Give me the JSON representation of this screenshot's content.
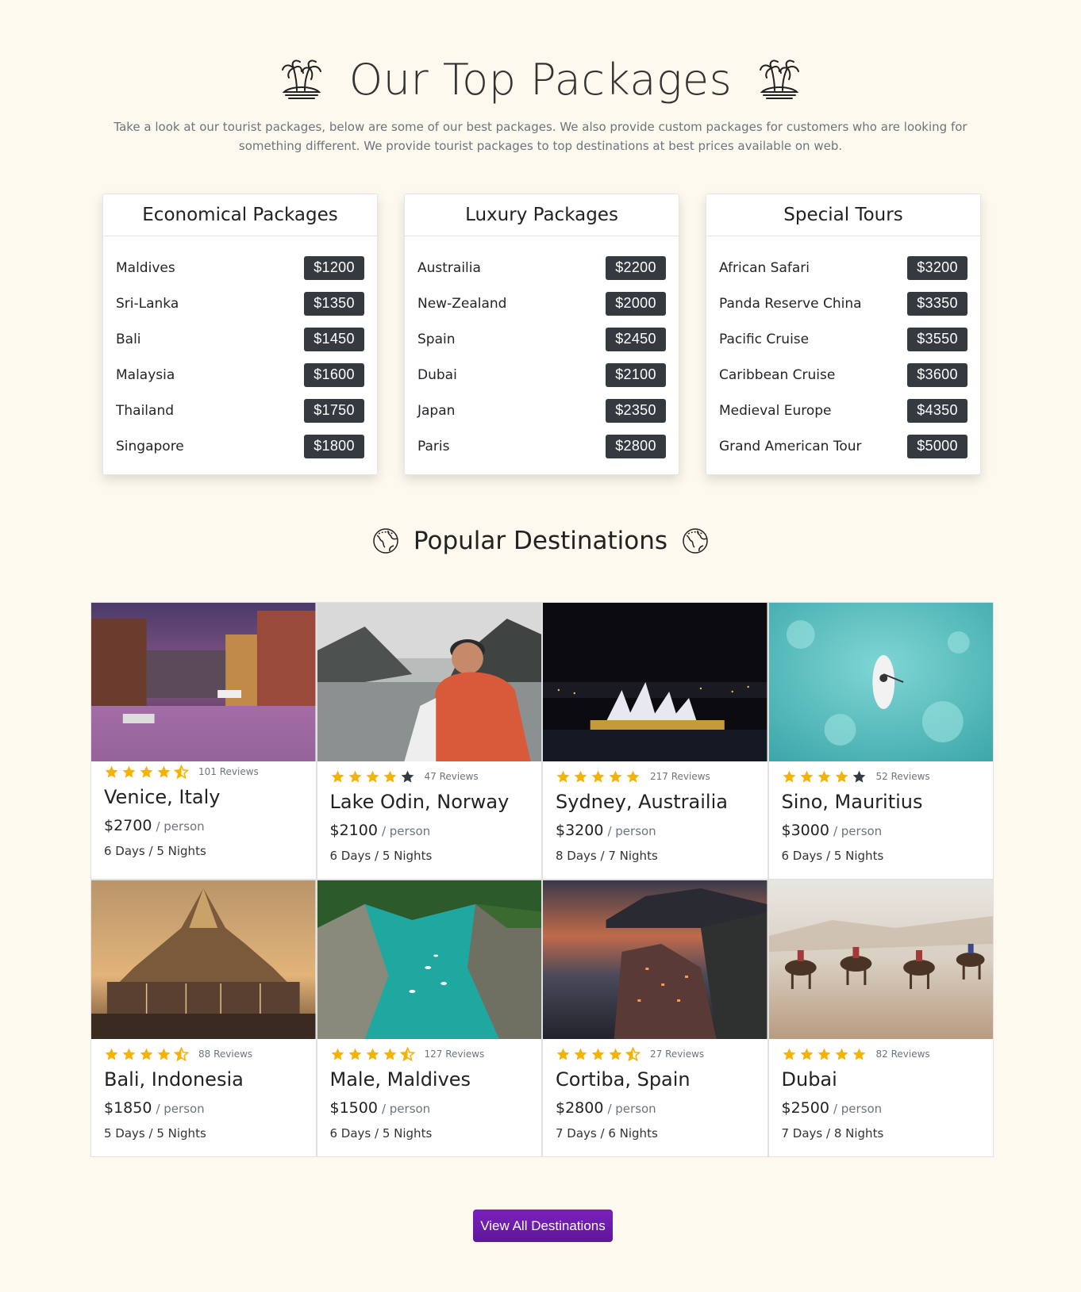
{
  "header": {
    "title": "Our Top Packages",
    "intro": "Take a look at our tourist packages, below are some of our best packages. We also provide custom packages for customers who are looking for something different. We provide tourist packages to top destinations at best prices available on web."
  },
  "packages": [
    {
      "title": "Economical Packages",
      "items": [
        {
          "name": "Maldives",
          "price": "$1200"
        },
        {
          "name": "Sri-Lanka",
          "price": "$1350"
        },
        {
          "name": "Bali",
          "price": "$1450"
        },
        {
          "name": "Malaysia",
          "price": "$1600"
        },
        {
          "name": "Thailand",
          "price": "$1750"
        },
        {
          "name": "Singapore",
          "price": "$1800"
        }
      ]
    },
    {
      "title": "Luxury Packages",
      "items": [
        {
          "name": "Austrailia",
          "price": "$2200"
        },
        {
          "name": "New-Zealand",
          "price": "$2000"
        },
        {
          "name": "Spain",
          "price": "$2450"
        },
        {
          "name": "Dubai",
          "price": "$2100"
        },
        {
          "name": "Japan",
          "price": "$2350"
        },
        {
          "name": "Paris",
          "price": "$2800"
        }
      ]
    },
    {
      "title": "Special Tours",
      "items": [
        {
          "name": "African Safari",
          "price": "$3200"
        },
        {
          "name": "Panda Reserve China",
          "price": "$3350"
        },
        {
          "name": "Pacific Cruise",
          "price": "$3550"
        },
        {
          "name": "Caribbean Cruise",
          "price": "$3600"
        },
        {
          "name": "Medieval Europe",
          "price": "$4350"
        },
        {
          "name": "Grand American Tour",
          "price": "$5000"
        }
      ]
    }
  ],
  "popular": {
    "title": "Popular Destinations",
    "per_label": "/ person",
    "destinations": [
      {
        "name": "Venice, Italy",
        "rating": 4.5,
        "reviews": "101 Reviews",
        "price": "$2700",
        "duration": "6 Days / 5 Nights",
        "image": "venice-canal-photo"
      },
      {
        "name": "Lake Odin, Norway",
        "rating": 4,
        "reviews": "47 Reviews",
        "price": "$2100",
        "duration": "6 Days / 5 Nights",
        "image": "hiker-lake-photo"
      },
      {
        "name": "Sydney, Austrailia",
        "rating": 5,
        "reviews": "217 Reviews",
        "price": "$3200",
        "duration": "8 Days / 7 Nights",
        "image": "opera-house-night-photo"
      },
      {
        "name": "Sino, Mauritius",
        "rating": 4,
        "reviews": "52 Reviews",
        "price": "$3000",
        "duration": "6 Days / 5 Nights",
        "image": "paddleboard-sea-photo"
      },
      {
        "name": "Bali, Indonesia",
        "rating": 4.5,
        "reviews": "88 Reviews",
        "price": "$1850",
        "duration": "5 Days / 5 Nights",
        "image": "temple-sunset-photo"
      },
      {
        "name": "Male, Maldives",
        "rating": 4.5,
        "reviews": "127 Reviews",
        "price": "$1500",
        "duration": "6 Days / 5 Nights",
        "image": "turquoise-gorge-photo"
      },
      {
        "name": "Cortiba, Spain",
        "rating": 4.5,
        "reviews": "27 Reviews",
        "price": "$2800",
        "duration": "7 Days / 6 Nights",
        "image": "cliff-village-dusk-photo"
      },
      {
        "name": "Dubai",
        "rating": 5,
        "reviews": "82 Reviews",
        "price": "$2500",
        "duration": "7 Days / 8 Nights",
        "image": "desert-camels-photo"
      }
    ]
  },
  "cta": {
    "label": "View All Destinations"
  },
  "colors": {
    "background": "#fdf9ee",
    "badge": "#343a40",
    "star": "#f5b301",
    "star_empty": "#343a40",
    "button": "#6f1bb0"
  }
}
